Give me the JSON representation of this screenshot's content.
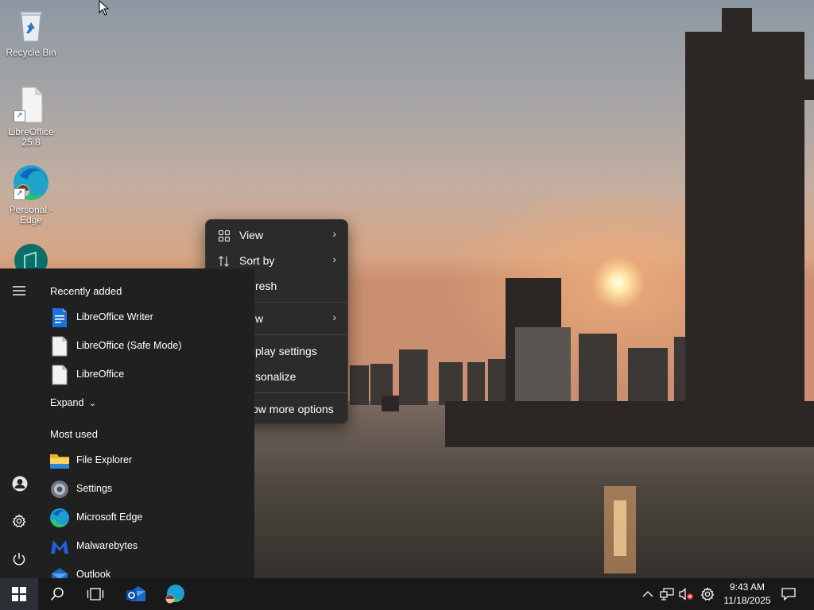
{
  "desktop": {
    "icons": [
      {
        "label": "Recycle Bin"
      },
      {
        "label": "LibreOffice 25.8"
      },
      {
        "label": "Personal - Edge"
      }
    ]
  },
  "context_menu": {
    "items": [
      {
        "label": "View",
        "has_submenu": true
      },
      {
        "label": "Sort by",
        "has_submenu": true
      },
      {
        "label": "Refresh",
        "visible_text": "resh"
      },
      {
        "label": "New",
        "visible_text": "w",
        "has_submenu": true
      },
      {
        "label": "Display settings",
        "visible_text": "play settings"
      },
      {
        "label": "Personalize",
        "visible_text": "sonalize"
      },
      {
        "label": "Show more options",
        "visible_text": "ow more options"
      }
    ]
  },
  "start_menu": {
    "recently_added_header": "Recently added",
    "recently_added": [
      {
        "label": "LibreOffice Writer",
        "icon": "libreoffice-writer-icon"
      },
      {
        "label": "LibreOffice (Safe Mode)",
        "icon": "libreoffice-doc-icon"
      },
      {
        "label": "LibreOffice",
        "icon": "libreoffice-doc-icon"
      }
    ],
    "expand_label": "Expand",
    "most_used_header": "Most used",
    "most_used": [
      {
        "label": "File Explorer",
        "icon": "folder-icon"
      },
      {
        "label": "Settings",
        "icon": "gear-icon"
      },
      {
        "label": "Microsoft Edge",
        "icon": "edge-icon"
      },
      {
        "label": "Malwarebytes",
        "icon": "malwarebytes-icon"
      },
      {
        "label": "Outlook",
        "icon": "outlook-icon"
      }
    ]
  },
  "taskbar": {
    "time": "9:43 AM",
    "date": "11/18/2025",
    "accent": "#2c3036"
  }
}
